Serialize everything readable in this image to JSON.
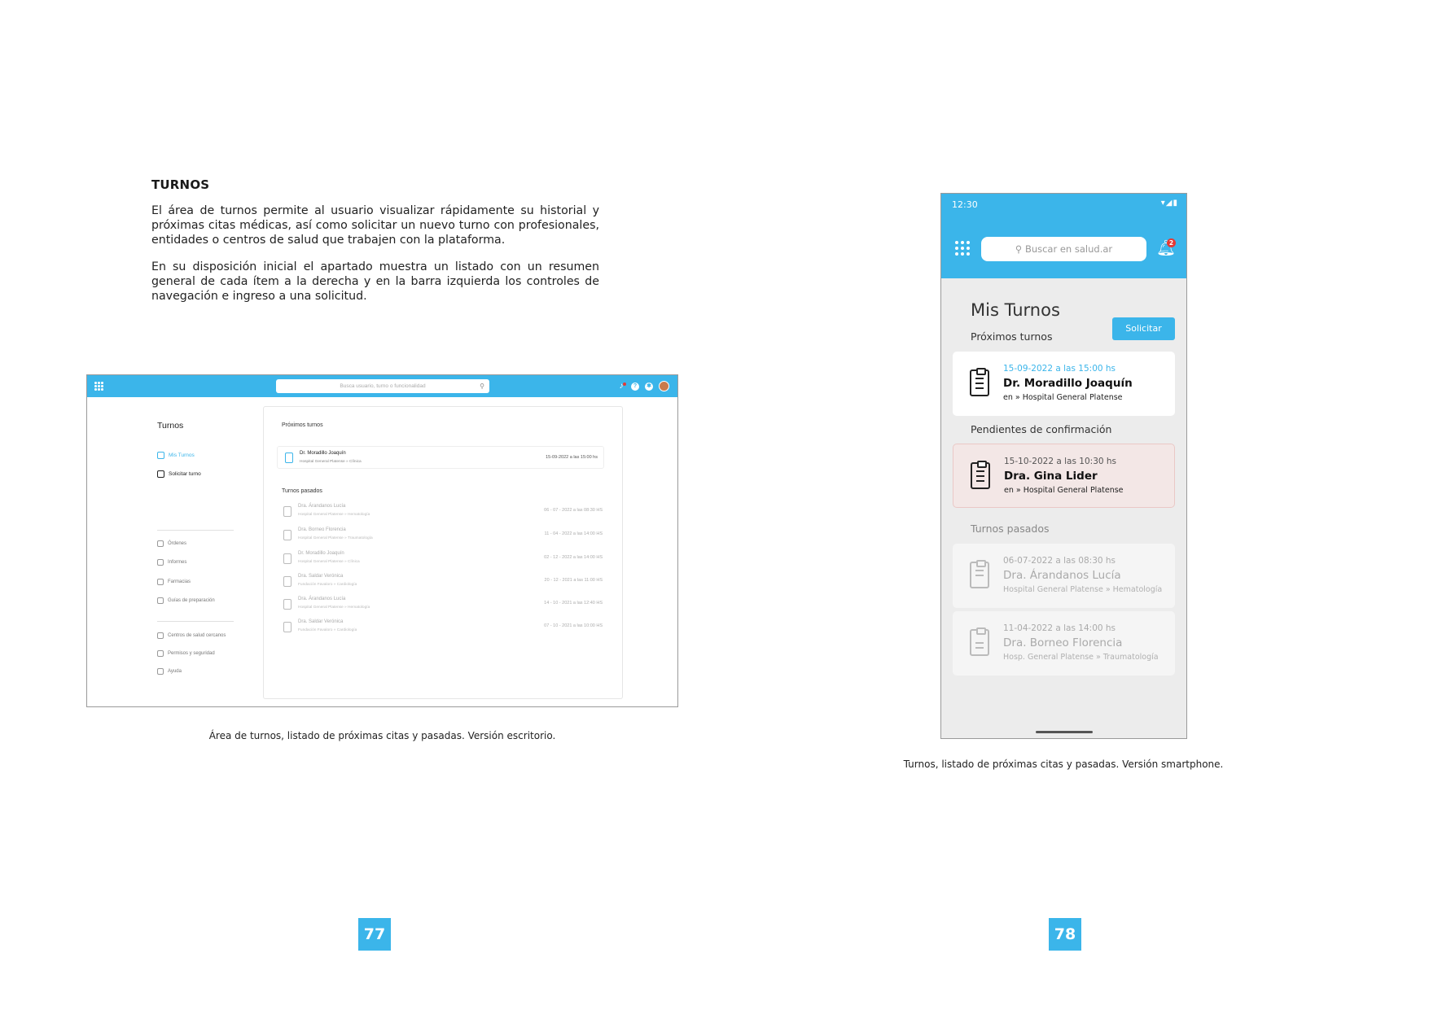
{
  "section_title": "TURNOS",
  "paragraphs": [
    "El área de turnos permite al usuario visualizar rápidamente su historial y próximas citas médicas, así como solicitar un nuevo turno con profesionales, entidades o centros de salud que trabajen con la plataforma.",
    "En su disposición inicial el apartado muestra un listado con un resumen general de cada ítem a la derecha y en la barra izquierda los controles de navegación e ingreso a una solicitud."
  ],
  "desktop": {
    "search_placeholder": "Busca usuario, turno o funcionalidad",
    "sidebar_title": "Turnos",
    "nav_primary": [
      {
        "label": "Mis Turnos",
        "icon": "calendar-icon"
      },
      {
        "label": "Solicitar turno",
        "icon": "calendar-plus-icon"
      }
    ],
    "nav_secondary": [
      {
        "label": "Órdenes",
        "icon": "orders-icon"
      },
      {
        "label": "Informes",
        "icon": "reports-icon"
      },
      {
        "label": "Farmacias",
        "icon": "pharmacy-icon"
      },
      {
        "label": "Guías de preparación",
        "icon": "guide-icon"
      }
    ],
    "nav_tertiary": [
      {
        "label": "Centros de salud cercanos",
        "icon": "location-icon"
      },
      {
        "label": "Permisos y seguridad",
        "icon": "lock-icon"
      },
      {
        "label": "Ayuda",
        "icon": "help-icon"
      }
    ],
    "upcoming_heading": "Próximos turnos",
    "upcoming": {
      "name": "Dr. Moradillo Joaquín",
      "place": "Hospital General Platense » Clínica",
      "date": "15-09-2022 a las 15:00 hs"
    },
    "past_heading": "Turnos pasados",
    "past": [
      {
        "name": "Dra. Árandanos Lucía",
        "place": "Hospital General Platense » Hematología",
        "date": "06 - 07 - 2022 a las 08:30 HS"
      },
      {
        "name": "Dra. Borneo Florencia",
        "place": "Hospital General Platense » Traumatología",
        "date": "11 - 04 - 2022 a las 14:00 HS"
      },
      {
        "name": "Dr. Moradillo Joaquín",
        "place": "Hospital General Platense » Clínica",
        "date": "02 - 12 - 2022 a las 14:00 HS"
      },
      {
        "name": "Dra. Saldar Verónica",
        "place": "Fundación Favaloro » Cardiología",
        "date": "20 - 12 - 2021 a las 11:00 HS"
      },
      {
        "name": "Dra. Árandanos Lucía",
        "place": "Hospital General Platense » Hematología",
        "date": "14 - 10 - 2021 a las 12:40 HS"
      },
      {
        "name": "Dra. Saldar Verónica",
        "place": "Fundación Favaloro » Cardiología",
        "date": "07 - 10 - 2021 a las 10:00 HS"
      }
    ]
  },
  "caption_desktop": "Área de turnos, listado de próximas citas y pasadas. Versión escritorio.",
  "phone": {
    "time": "12:30",
    "status_icons": "▾◢▮",
    "search_placeholder": "Buscar en salud.ar",
    "notif_count": "2",
    "title": "Mis Turnos",
    "solicitar": "Solicitar",
    "upcoming_heading": "Próximos turnos",
    "upcoming": {
      "date": "15-09-2022 a las 15:00 hs",
      "name": "Dr. Moradillo Joaquín",
      "place": "en » Hospital General Platense"
    },
    "pending_heading": "Pendientes de confirmación",
    "pending": {
      "date": "15-10-2022 a las 10:30 hs",
      "name": "Dra. Gina Lider",
      "place": "en » Hospital General Platense"
    },
    "past_heading": "Turnos pasados",
    "past": [
      {
        "date": "06-07-2022 a las 08:30 hs",
        "name": "Dra. Árandanos Lucía",
        "place": "Hospital General Platense » Hematología"
      },
      {
        "date": "11-04-2022 a las 14:00 hs",
        "name": "Dra. Borneo Florencia",
        "place": "Hosp. General Platense » Traumatología"
      }
    ]
  },
  "caption_phone": "Turnos, listado de próximas citas y pasadas. Versión smartphone.",
  "page_numbers": [
    "77",
    "78"
  ],
  "colors": {
    "accent": "#3bb5ea",
    "pending_bg": "#f3e7e6",
    "badge": "#e53935"
  }
}
